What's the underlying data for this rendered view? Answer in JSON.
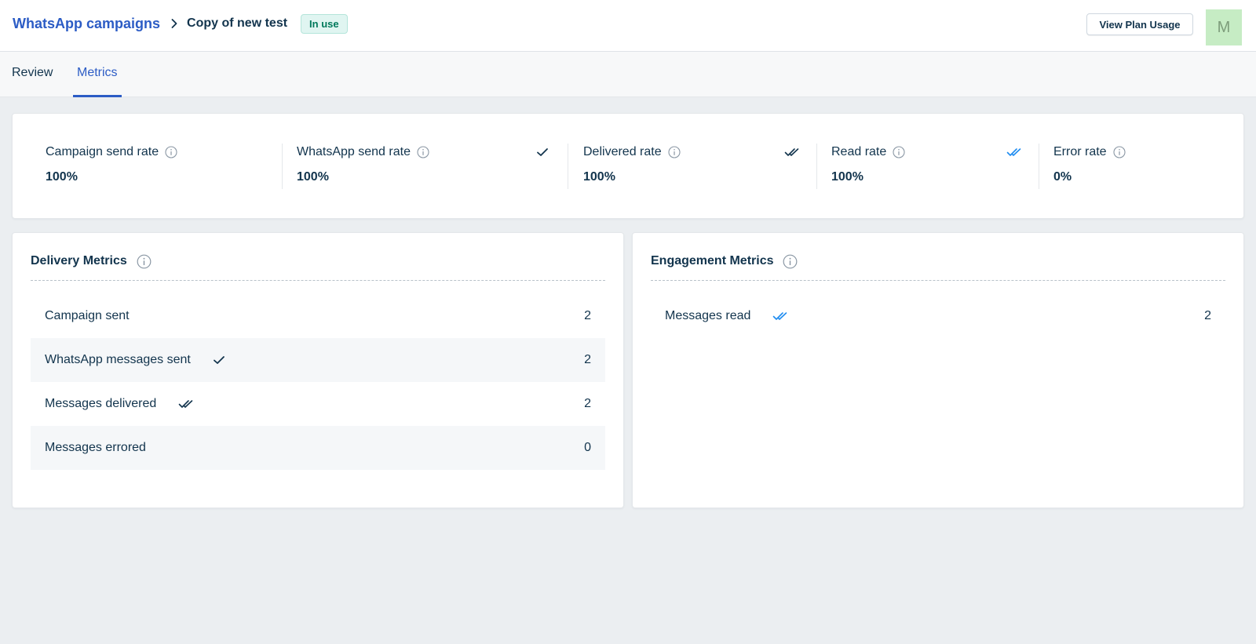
{
  "header": {
    "breadcrumb_link": "WhatsApp campaigns",
    "breadcrumb_current": "Copy of new test",
    "status": "In use",
    "plan_button": "View Plan Usage",
    "avatar_initial": "M"
  },
  "tabs": [
    {
      "label": "Review"
    },
    {
      "label": "Metrics"
    }
  ],
  "rates": [
    {
      "label": "Campaign send rate",
      "value": "100%"
    },
    {
      "label": "WhatsApp send rate",
      "value": "100%",
      "icon": "single-check-icon"
    },
    {
      "label": "Delivered rate",
      "value": "100%",
      "icon": "double-check-icon"
    },
    {
      "label": "Read rate",
      "value": "100%",
      "icon": "double-check-blue-icon"
    },
    {
      "label": "Error rate",
      "value": "0%"
    }
  ],
  "delivery": {
    "title": "Delivery Metrics",
    "rows": [
      {
        "label": "Campaign sent",
        "value": "2"
      },
      {
        "label": "WhatsApp messages sent",
        "value": "2",
        "icon": "single-check-icon"
      },
      {
        "label": "Messages delivered",
        "value": "2",
        "icon": "double-check-icon"
      },
      {
        "label": "Messages errored",
        "value": "0"
      }
    ]
  },
  "engagement": {
    "title": "Engagement Metrics",
    "rows": [
      {
        "label": "Messages read",
        "value": "2",
        "icon": "double-check-blue-icon"
      }
    ]
  },
  "colors": {
    "accent": "#2c5cc5",
    "text": "#12344d",
    "read_tick": "#1f8cf0",
    "badge_bg": "#e0f5f1",
    "badge_text": "#00795b",
    "avatar_bg": "#c6ecc4",
    "page_bg": "#ebeef1"
  }
}
